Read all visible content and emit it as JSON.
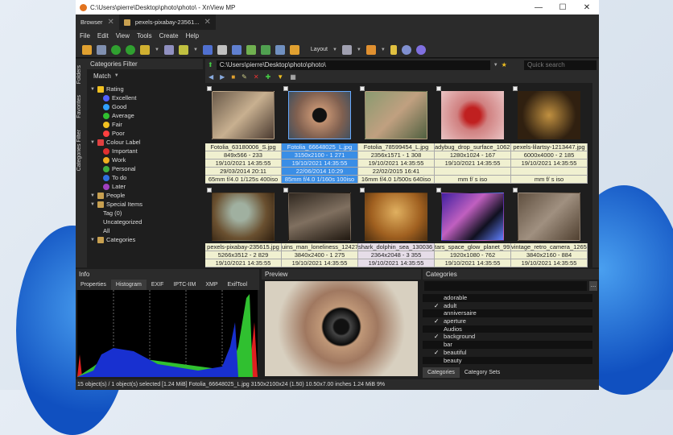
{
  "window": {
    "title": "C:\\Users\\pierre\\Desktop\\photo\\photo\\ - XnView MP",
    "min": "—",
    "max": "☐",
    "close": "✕"
  },
  "tabs": [
    {
      "label": "Browser"
    },
    {
      "label": "pexels-pixabay-23561..."
    }
  ],
  "menu": [
    "File",
    "Edit",
    "View",
    "Tools",
    "Create",
    "Help"
  ],
  "toolbar": {
    "layout_label": "Layout"
  },
  "left_panel": {
    "title": "Categories Filter",
    "match_label": "Match",
    "side_tabs": [
      "Folders",
      "Favorites",
      "Categories Filter"
    ],
    "tree": [
      {
        "label": "Rating",
        "level": 0,
        "icon": "rating-icon",
        "color": "#f0c020"
      },
      {
        "label": "Excellent",
        "level": 1,
        "icon": "star-icon",
        "color": "#5060ff"
      },
      {
        "label": "Good",
        "level": 1,
        "icon": "star-icon",
        "color": "#30a0ff"
      },
      {
        "label": "Average",
        "level": 1,
        "icon": "star-icon",
        "color": "#30c030"
      },
      {
        "label": "Fair",
        "level": 1,
        "icon": "star-icon",
        "color": "#f0c020"
      },
      {
        "label": "Poor",
        "level": 1,
        "icon": "star-icon",
        "color": "#ff4040"
      },
      {
        "label": "Colour Label",
        "level": 0,
        "icon": "color-label-icon",
        "color": "#e04040"
      },
      {
        "label": "Important",
        "level": 1,
        "icon": "dot-icon",
        "color": "#e03030"
      },
      {
        "label": "Work",
        "level": 1,
        "icon": "dot-icon",
        "color": "#f0b020"
      },
      {
        "label": "Personal",
        "level": 1,
        "icon": "dot-icon",
        "color": "#40b040"
      },
      {
        "label": "To do",
        "level": 1,
        "icon": "dot-icon",
        "color": "#3070e0"
      },
      {
        "label": "Later",
        "level": 1,
        "icon": "dot-icon",
        "color": "#a040c0"
      },
      {
        "label": "People",
        "level": 0,
        "icon": "folder-icon",
        "color": "#c8a050"
      },
      {
        "label": "Special Items",
        "level": 0,
        "icon": "folder-icon",
        "color": "#c8a050"
      },
      {
        "label": "Tag (0)",
        "level": 1,
        "icon": "",
        "color": ""
      },
      {
        "label": "Uncategorized",
        "level": 1,
        "icon": "",
        "color": ""
      },
      {
        "label": "All",
        "level": 1,
        "icon": "",
        "color": ""
      },
      {
        "label": "Categories",
        "level": 0,
        "icon": "folder-icon",
        "color": "#c8a050"
      }
    ]
  },
  "browser": {
    "path": "C:\\Users\\pierre\\Desktop\\photo\\photo\\",
    "search_placeholder": "Quick search",
    "items": [
      {
        "name": "Fotolia_63180006_S.jpg",
        "dims": "849x566 - 233",
        "date": "19/10/2021 14:35:55",
        "taken": "29/03/2014 20:11",
        "exif": "65mm f/4.0 1/125s 400iso",
        "g": "linear-gradient(135deg,#6a5a4a,#c8b090,#4a3a30)"
      },
      {
        "name": "Fotolia_66648025_L.jpg",
        "dims": "3150x2100 - 1 271",
        "date": "19/10/2021 14:35:55",
        "taken": "22/06/2014 10:29",
        "exif": "85mm f/4.0 1/160s 100iso",
        "g": "radial-gradient(circle,#111 18%,#c09070 20%,#806050 60%,#405060)",
        "selected": true
      },
      {
        "name": "Fotolia_78599454_L.jpg",
        "dims": "2356x1571 - 1 308",
        "date": "19/10/2021 14:35:55",
        "taken": "22/02/2015 16:41",
        "exif": "16mm f/4.0 1/500s 640iso",
        "g": "linear-gradient(135deg,#8a9a70,#c0a080,#506040)"
      },
      {
        "name": "adybug_drop_surface_1062...",
        "dims": "1280x1024 - 167",
        "date": "19/10/2021 14:35:55",
        "taken": "",
        "exif": "mm f/ s iso",
        "g": "radial-gradient(circle at 50% 50%,#c02020 20%,#d08080 40%,#e8c0c0)"
      },
      {
        "name": "pexels-lilartsy-1213447.jpg",
        "dims": "6000x4000 - 2 185",
        "date": "19/10/2021 14:35:55",
        "taken": "",
        "exif": "mm f/ s iso",
        "g": "radial-gradient(circle,#c09040,#302010 70%)"
      },
      {
        "name": "pexels-pixabay-235615.jpg",
        "dims": "5266x3512 - 2 829",
        "date": "19/10/2021 14:35:55",
        "g": "radial-gradient(circle at 45% 40%,#a0b0a0 20%,#6a5030 60%,#302010)"
      },
      {
        "name": "uins_man_loneliness_12427...",
        "dims": "3840x2400 - 1 275",
        "date": "19/10/2021 14:35:55",
        "g": "linear-gradient(160deg,#302820,#807060,#201810)"
      },
      {
        "name": "shark_dolphin_sea_130036_...",
        "dims": "2364x2048 - 3 355",
        "date": "19/10/2021 14:35:55",
        "g": "radial-gradient(circle at 50% 40%,#e0b060,#a06020 60%,#503010)",
        "hl": true
      },
      {
        "name": "tars_space_glow_planet_99...",
        "dims": "1920x1080 - 762",
        "date": "19/10/2021 14:35:55",
        "g": "linear-gradient(135deg,#4020a0,#c060c0 40%,#101020 70%,#6080ff)"
      },
      {
        "name": "vintage_retro_camera_1265...",
        "dims": "3840x2160 - 884",
        "date": "19/10/2021 14:35:55",
        "g": "linear-gradient(135deg,#605040,#a09080,#504030)"
      }
    ]
  },
  "info": {
    "title": "Info",
    "tabs": [
      "Properties",
      "Histogram",
      "EXIF",
      "IPTC-IIM",
      "XMP",
      "ExifTool"
    ],
    "active_tab": "Histogram"
  },
  "preview": {
    "title": "Preview"
  },
  "categories": {
    "title": "Categories",
    "items": [
      {
        "label": "adorable",
        "checked": false
      },
      {
        "label": "adult",
        "checked": true
      },
      {
        "label": "anniversaire",
        "checked": false
      },
      {
        "label": "aperture",
        "checked": true
      },
      {
        "label": "Audios",
        "checked": false
      },
      {
        "label": "background",
        "checked": true
      },
      {
        "label": "bar",
        "checked": false
      },
      {
        "label": "beautiful",
        "checked": true
      },
      {
        "label": "beauty",
        "checked": false
      }
    ],
    "tabs": [
      "Categories",
      "Category Sets"
    ],
    "more_label": "..."
  },
  "status": "15 object(s) / 1 object(s) selected [1.24 MiB]   Fotolia_66648025_L.jpg   3150x2100x24 (1.50)   10.50x7.00 inches   1.24 MiB   9%"
}
